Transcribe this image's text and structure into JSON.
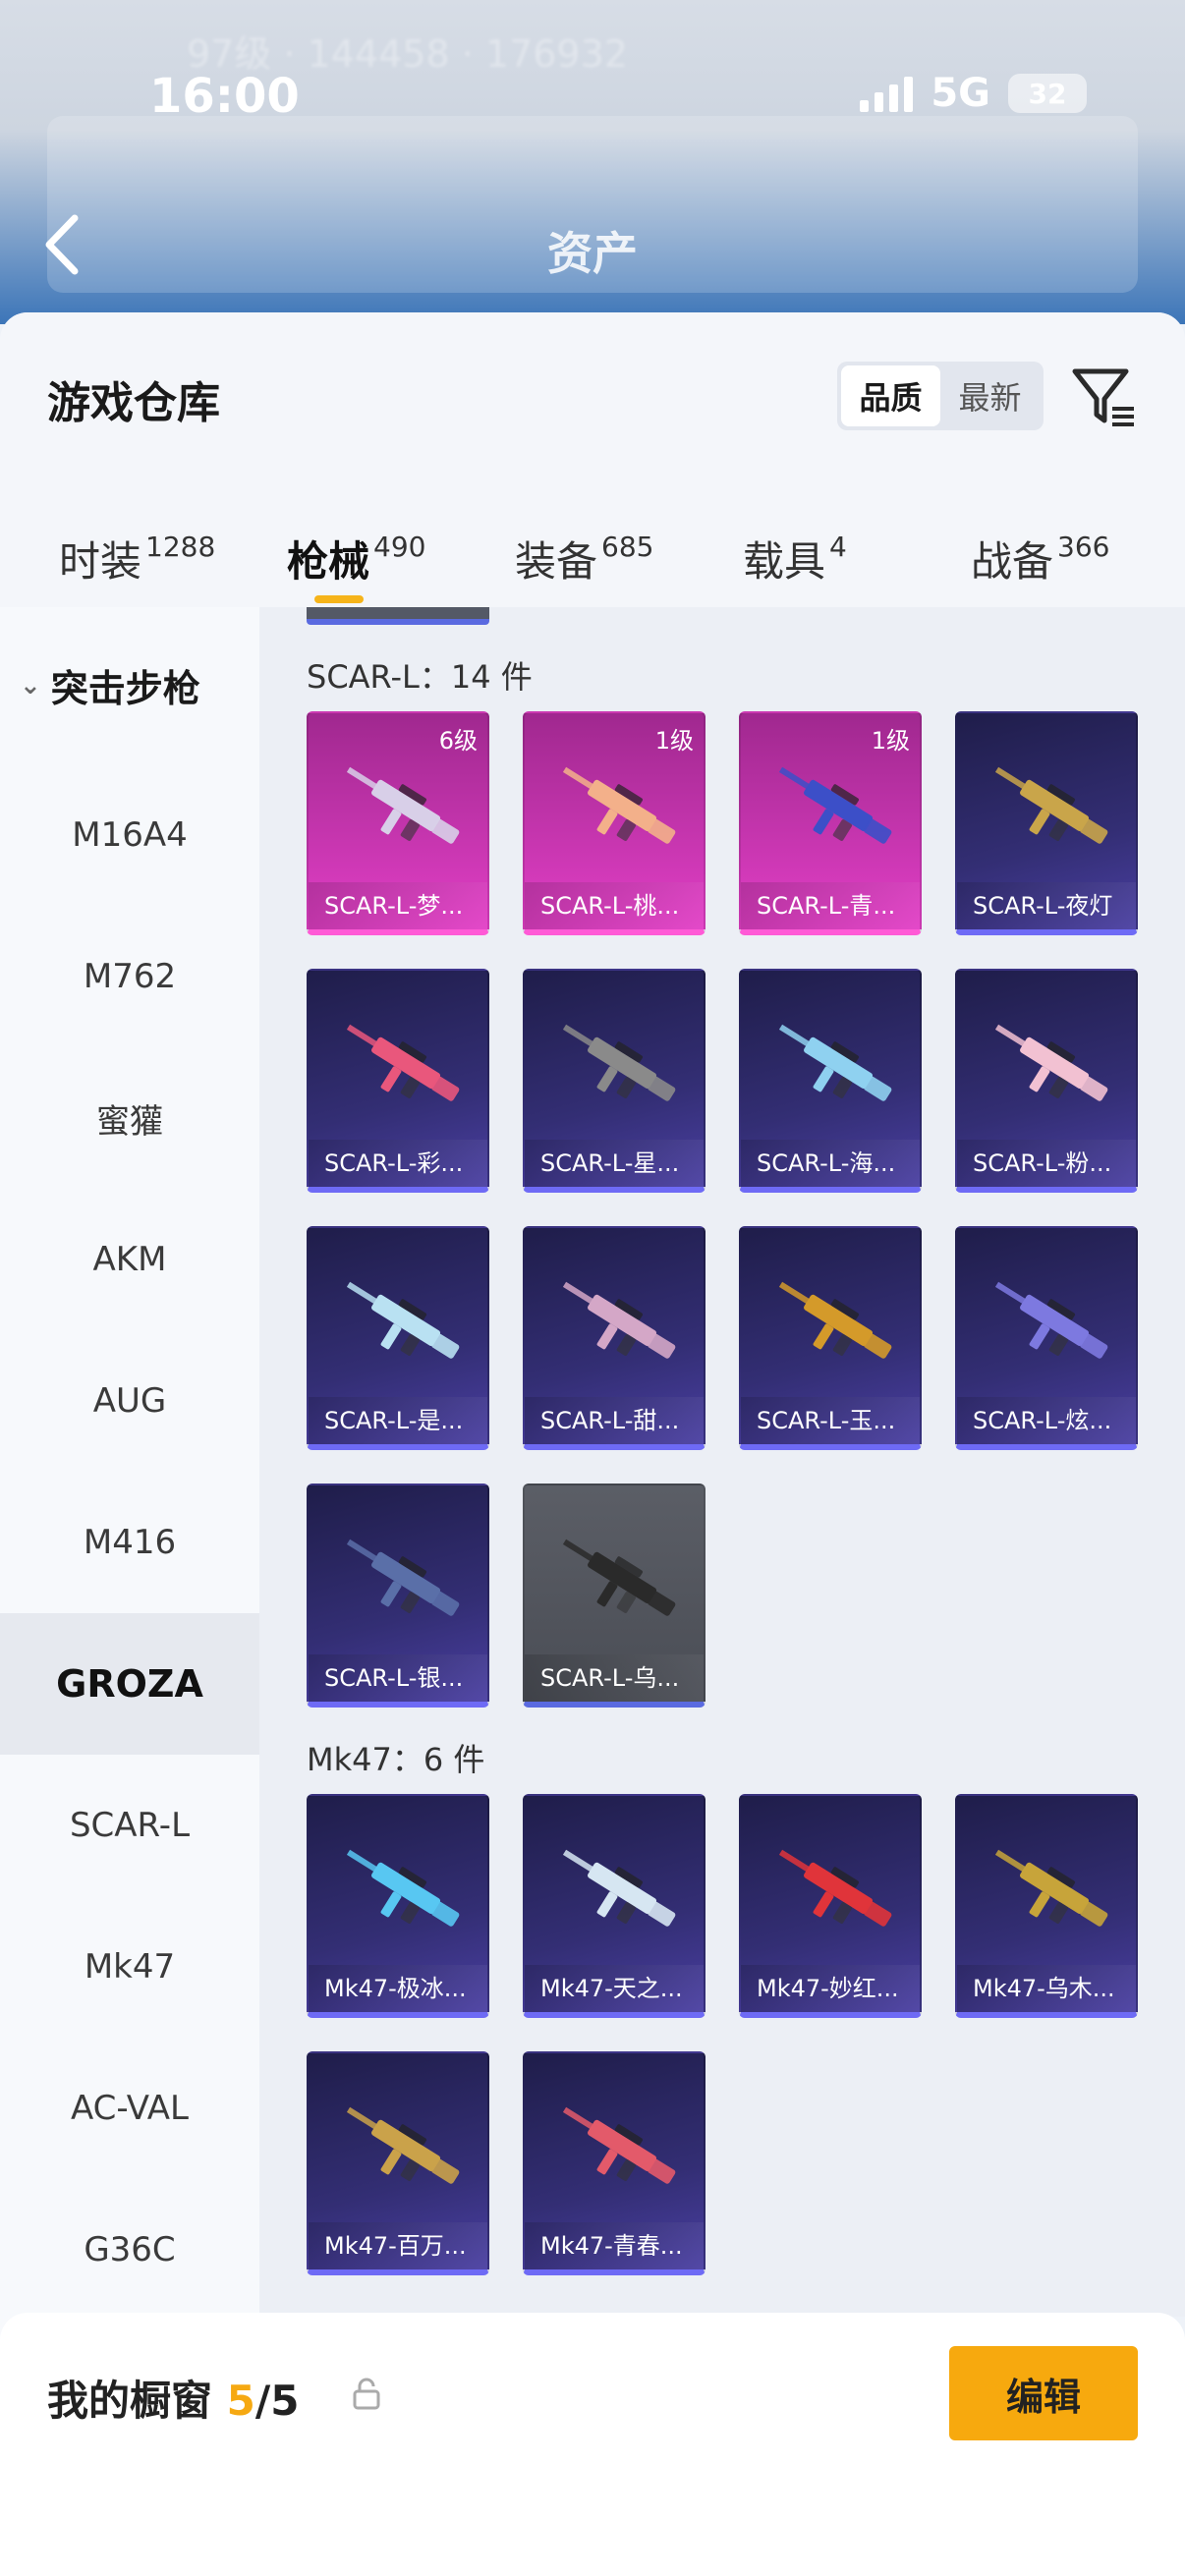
{
  "status": {
    "time": "16:00",
    "network": "5G",
    "battery": "32"
  },
  "header": {
    "title": "资产"
  },
  "warehouse": {
    "title": "游戏仓库",
    "sort_options": [
      "品质",
      "最新"
    ],
    "tabs": [
      {
        "label": "时装",
        "count": "1288"
      },
      {
        "label": "枪械",
        "count": "490"
      },
      {
        "label": "装备",
        "count": "685"
      },
      {
        "label": "载具",
        "count": "4"
      },
      {
        "label": "战备",
        "count": "366"
      }
    ]
  },
  "categories": {
    "group": "突击步枪",
    "items": [
      "M16A4",
      "M762",
      "蜜獾",
      "AKM",
      "AUG",
      "M416",
      "GROZA",
      "SCAR-L",
      "Mk47",
      "AC-VAL",
      "G36C"
    ],
    "selected": "GROZA"
  },
  "sections": [
    {
      "title": "SCAR-L：14 件",
      "items": [
        {
          "name": "SCAR-L-梦...",
          "level": "6级",
          "quality": "pink",
          "color": "#d8cfe8"
        },
        {
          "name": "SCAR-L-桃...",
          "level": "1级",
          "quality": "pink",
          "color": "#f3b08a"
        },
        {
          "name": "SCAR-L-青...",
          "level": "1级",
          "quality": "pink",
          "color": "#3c4fc8"
        },
        {
          "name": "SCAR-L-夜灯",
          "level": "",
          "quality": "purple",
          "color": "#c9a54a"
        },
        {
          "name": "SCAR-L-彩...",
          "level": "",
          "quality": "purple",
          "color": "#e9577c"
        },
        {
          "name": "SCAR-L-星...",
          "level": "",
          "quality": "purple",
          "color": "#8a8a8a"
        },
        {
          "name": "SCAR-L-海...",
          "level": "",
          "quality": "purple",
          "color": "#8fd1f0"
        },
        {
          "name": "SCAR-L-粉...",
          "level": "",
          "quality": "purple",
          "color": "#f2c1d2"
        },
        {
          "name": "SCAR-L-是...",
          "level": "",
          "quality": "purple",
          "color": "#b9e1f2"
        },
        {
          "name": "SCAR-L-甜...",
          "level": "",
          "quality": "purple",
          "color": "#d4a7c7"
        },
        {
          "name": "SCAR-L-玉...",
          "level": "",
          "quality": "purple",
          "color": "#d49a2a"
        },
        {
          "name": "SCAR-L-炫...",
          "level": "",
          "quality": "purple",
          "color": "#7d79e0"
        },
        {
          "name": "SCAR-L-银...",
          "level": "",
          "quality": "purple",
          "color": "#5a6fa8"
        },
        {
          "name": "SCAR-L-乌...",
          "level": "",
          "quality": "grey",
          "color": "#2a2a2a"
        }
      ]
    },
    {
      "title": "Mk47：6 件",
      "items": [
        {
          "name": "Mk47-极冰...",
          "level": "",
          "quality": "purple",
          "color": "#58c7f2"
        },
        {
          "name": "Mk47-天之...",
          "level": "",
          "quality": "purple",
          "color": "#d6e6f2"
        },
        {
          "name": "Mk47-妙红...",
          "level": "",
          "quality": "purple",
          "color": "#e0343a"
        },
        {
          "name": "Mk47-乌木...",
          "level": "",
          "quality": "purple",
          "color": "#c7a43a"
        },
        {
          "name": "Mk47-百万...",
          "level": "",
          "quality": "purple",
          "color": "#caa24a"
        },
        {
          "name": "Mk47-青春...",
          "level": "",
          "quality": "purple",
          "color": "#e35a6a"
        }
      ]
    }
  ],
  "showcase": {
    "title": "我的橱窗",
    "used": "5",
    "total": "/5",
    "edit_label": "编辑"
  }
}
